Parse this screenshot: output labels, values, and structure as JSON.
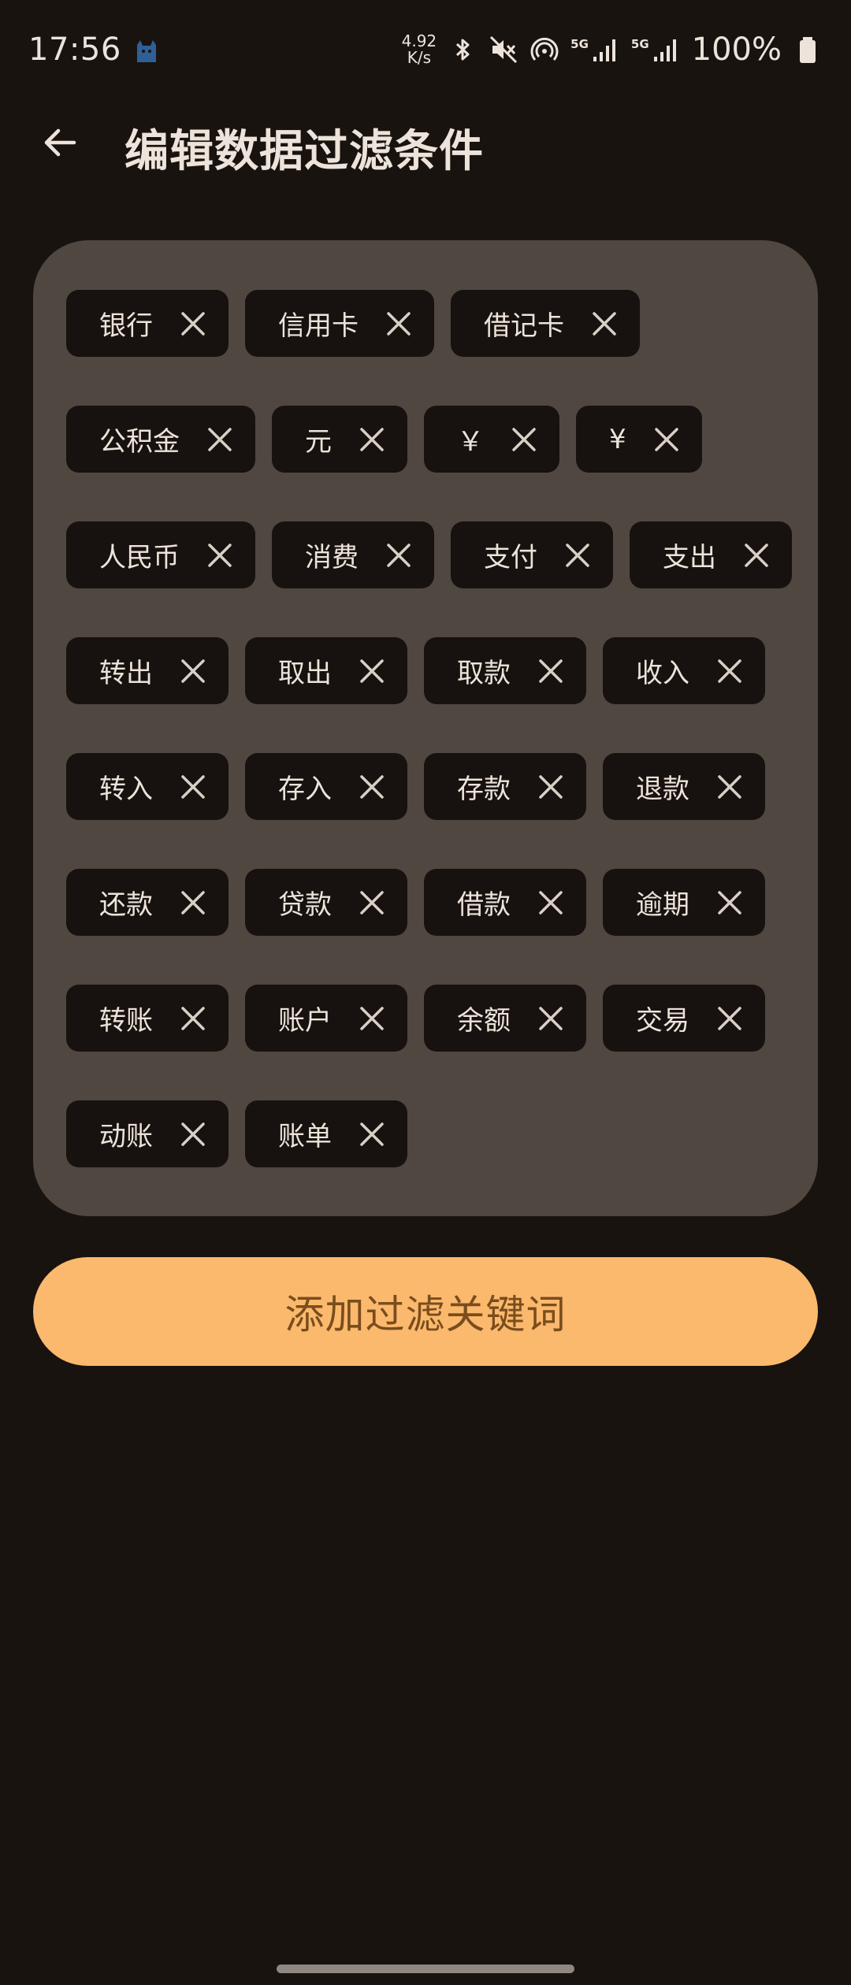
{
  "status_bar": {
    "time": "17:56",
    "net_speed_value": "4.92",
    "net_speed_unit": "K/s",
    "sim1_label": "5G",
    "sim2_label": "5G",
    "battery": "100%"
  },
  "app_bar": {
    "title": "编辑数据过滤条件",
    "back_icon": "arrow-left-icon"
  },
  "chips": {
    "rows": [
      [
        {
          "label": "银行"
        },
        {
          "label": "信用卡"
        },
        {
          "label": "借记卡"
        }
      ],
      [
        {
          "label": "公积金"
        },
        {
          "label": "元"
        },
        {
          "label": "￥"
        },
        {
          "label": "¥"
        }
      ],
      [
        {
          "label": "人民币"
        },
        {
          "label": "消费"
        },
        {
          "label": "支付"
        },
        {
          "label": "支出"
        }
      ],
      [
        {
          "label": "转出"
        },
        {
          "label": "取出"
        },
        {
          "label": "取款"
        },
        {
          "label": "收入"
        }
      ],
      [
        {
          "label": "转入"
        },
        {
          "label": "存入"
        },
        {
          "label": "存款"
        },
        {
          "label": "退款"
        }
      ],
      [
        {
          "label": "还款"
        },
        {
          "label": "贷款"
        },
        {
          "label": "借款"
        },
        {
          "label": "逾期"
        }
      ],
      [
        {
          "label": "转账"
        },
        {
          "label": "账户"
        },
        {
          "label": "余额"
        },
        {
          "label": "交易"
        }
      ],
      [
        {
          "label": "动账"
        },
        {
          "label": "账单"
        }
      ]
    ],
    "close_icon": "close-icon"
  },
  "add_button": {
    "label": "添加过滤关键词"
  },
  "colors": {
    "background": "#18130f",
    "panel": "#4f4740",
    "chip": "#17120f",
    "accent": "#fbb96e",
    "accent_text": "#7a4d1c",
    "text": "#ede3da"
  }
}
